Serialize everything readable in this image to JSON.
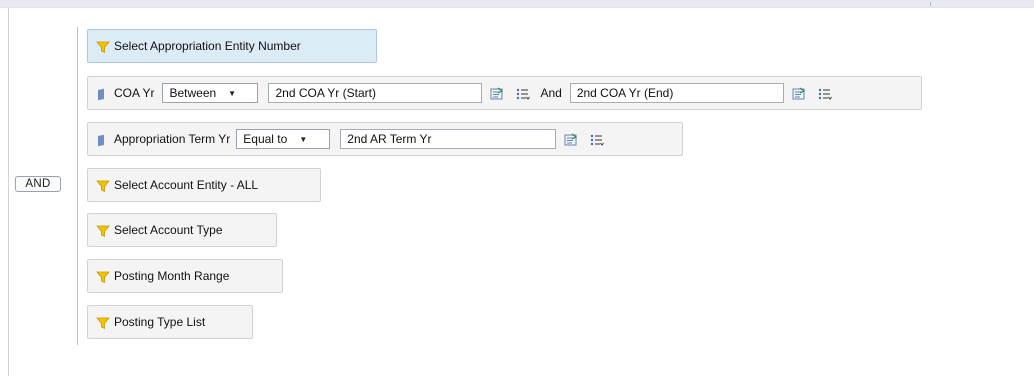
{
  "header": {},
  "operator": {
    "label": "AND"
  },
  "filters": [
    {
      "label": "Select Appropriation Entity Number",
      "type": "prompt",
      "selected": true
    },
    {
      "label": "COA Yr",
      "type": "dimension",
      "operator": "Between",
      "value_start": "2nd COA Yr (Start)",
      "and_label": "And",
      "value_end": "2nd COA Yr (End)"
    },
    {
      "label": "Appropriation Term Yr",
      "type": "dimension",
      "operator": "Equal to",
      "value": "2nd AR Term Yr"
    },
    {
      "label": "Select Account Entity - ALL",
      "type": "prompt"
    },
    {
      "label": "Select Account Type",
      "type": "prompt"
    },
    {
      "label": "Posting Month Range",
      "type": "prompt"
    },
    {
      "label": "Posting Type List",
      "type": "prompt"
    }
  ],
  "icons": {
    "prompt": "funnel-icon",
    "dimension": "dimension-flag-icon",
    "value_picker": "prompt-value-icon",
    "list": "list-values-icon"
  },
  "colors": {
    "selected_bg": "#dcecf7",
    "filter_bg": "#f4f4f4",
    "funnel": "#f2c300",
    "dimension": "#6f8fc4"
  }
}
